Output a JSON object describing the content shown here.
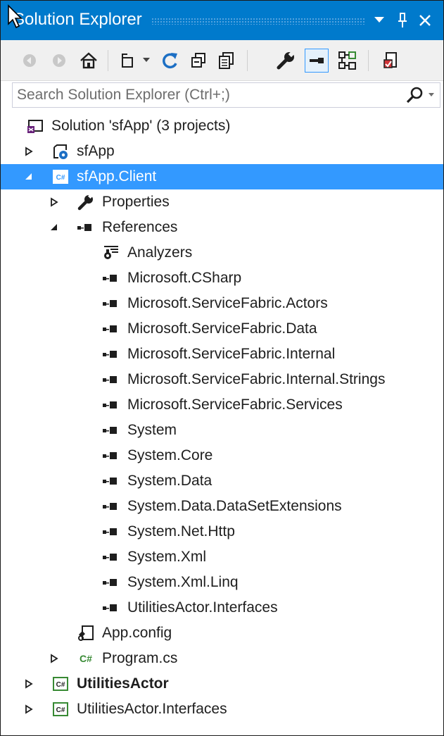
{
  "window": {
    "title": "Solution Explorer",
    "buttons": [
      {
        "name": "window-options-button",
        "glyph": "▼"
      },
      {
        "name": "pin-button",
        "glyph": "⊥"
      },
      {
        "name": "close-button",
        "glyph": "✕"
      }
    ]
  },
  "toolbar": {
    "icons": [
      "back-icon",
      "forward-icon",
      "home-icon",
      "switch-views-icon",
      "refresh-icon",
      "collapse-all-icon",
      "show-all-files-icon",
      "properties-icon",
      "preview-selected-items-icon",
      "class-view-icon",
      "pending-changes-icon"
    ]
  },
  "search": {
    "placeholder": "Search Solution Explorer (Ctrl+;)"
  },
  "tree": [
    {
      "label": "Solution 'sfApp' (3 projects)",
      "icon": "solution-icon",
      "expander": "none"
    },
    {
      "label": "sfApp",
      "icon": "service-fabric-app-icon",
      "expander": "collapsed"
    },
    {
      "label": "sfApp.Client",
      "icon": "csharp-project-icon",
      "expander": "expanded",
      "selected": true
    },
    {
      "label": "Properties",
      "icon": "wrench-icon",
      "expander": "collapsed"
    },
    {
      "label": "References",
      "icon": "references-icon",
      "expander": "expanded"
    },
    {
      "label": "Analyzers",
      "icon": "analyzer-icon",
      "expander": "none"
    },
    {
      "label": "Microsoft.CSharp",
      "icon": "reference-icon",
      "expander": "none"
    },
    {
      "label": "Microsoft.ServiceFabric.Actors",
      "icon": "reference-icon",
      "expander": "none"
    },
    {
      "label": "Microsoft.ServiceFabric.Data",
      "icon": "reference-icon",
      "expander": "none"
    },
    {
      "label": "Microsoft.ServiceFabric.Internal",
      "icon": "reference-icon",
      "expander": "none"
    },
    {
      "label": "Microsoft.ServiceFabric.Internal.Strings",
      "icon": "reference-icon",
      "expander": "none"
    },
    {
      "label": "Microsoft.ServiceFabric.Services",
      "icon": "reference-icon",
      "expander": "none"
    },
    {
      "label": "System",
      "icon": "reference-icon",
      "expander": "none"
    },
    {
      "label": "System.Core",
      "icon": "reference-icon",
      "expander": "none"
    },
    {
      "label": "System.Data",
      "icon": "reference-icon",
      "expander": "none"
    },
    {
      "label": "System.Data.DataSetExtensions",
      "icon": "reference-icon",
      "expander": "none"
    },
    {
      "label": "System.Net.Http",
      "icon": "reference-icon",
      "expander": "none"
    },
    {
      "label": "System.Xml",
      "icon": "reference-icon",
      "expander": "none"
    },
    {
      "label": "System.Xml.Linq",
      "icon": "reference-icon",
      "expander": "none"
    },
    {
      "label": "UtilitiesActor.Interfaces",
      "icon": "reference-icon",
      "expander": "none"
    },
    {
      "label": "App.config",
      "icon": "config-file-icon",
      "expander": "none"
    },
    {
      "label": "Program.cs",
      "icon": "csharp-file-icon",
      "expander": "collapsed"
    },
    {
      "label": "UtilitiesActor",
      "icon": "csharp-project-icon",
      "expander": "collapsed",
      "bold": true
    },
    {
      "label": "UtilitiesActor.Interfaces",
      "icon": "csharp-project-icon",
      "expander": "collapsed"
    }
  ],
  "colors": {
    "titlebar": "#007acc",
    "selection": "#3399ff",
    "csharp_green": "#388a34"
  }
}
